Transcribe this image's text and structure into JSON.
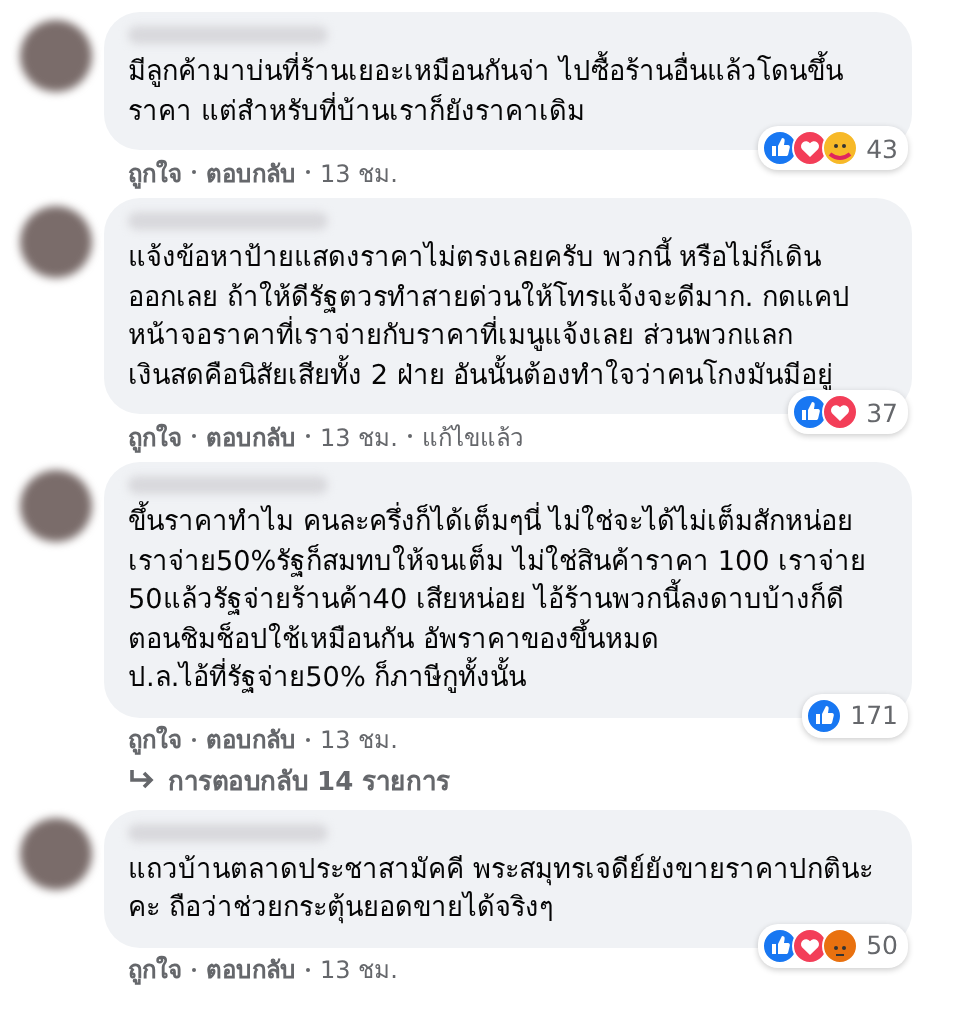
{
  "comments": [
    {
      "text": "มีลูกค้ามาบ่นที่ร้านเยอะเหมือนกันจ่า ไปซื้อร้านอื่นแล้วโดนขึ้น\nราคา แต่สำหรับที่บ้านเราก็ยังราคาเดิม",
      "reactions": [
        {
          "kind": "like"
        },
        {
          "kind": "love"
        },
        {
          "kind": "care"
        }
      ],
      "count": "43",
      "actions": [
        "ถูกใจ",
        "ตอบกลับ"
      ],
      "time": "13 ชม."
    },
    {
      "text": "แจ้งข้อหาป้ายแสดงราคาไม่ตรงเลยครับ พวกนี้ หรือไม่ก็เดิน\nออกเลย ถ้าให้ดีรัฐตวรทำสายด่วนให้โทรแจ้งจะดีมาก. กดแคป\nหน้าจอราคาที่เราจ่ายกับราคาที่เมนูแจ้งเลย ส่วนพวกแลก\nเงินสดคือนิสัยเสียทั้ง 2 ฝ่าย อันนั้นต้องทำใจว่าคนโกงมันมีอยู่",
      "reactions": [
        {
          "kind": "like"
        },
        {
          "kind": "love"
        }
      ],
      "count": "37",
      "actions": [
        "ถูกใจ",
        "ตอบกลับ"
      ],
      "time": "13 ชม.",
      "edited": "แก้ไขแล้ว"
    },
    {
      "text": "ขึ้นราคาทำไม คนละครึ่งก็ได้เต็มๆนี่ ไม่ใช่จะได้ไม่เต็มสักหน่อย\nเราจ่าย50%รัฐก็สมทบให้จนเต็ม ไม่ใช่สินค้าราคา 100 เราจ่าย\n50แล้วรัฐจ่ายร้านค้า40 เสียหน่อย ไอ้ร้านพวกนี้ลงดาบบ้างก็ดี\nตอนชิมช็อปใช้เหมือนกัน อัพราคาของขึ้นหมด\nป.ล.ไอ้ที่รัฐจ่าย50% ก็ภาษีกูทั้งนั้น",
      "reactions": [
        {
          "kind": "like"
        }
      ],
      "count": "171",
      "actions": [
        "ถูกใจ",
        "ตอบกลับ"
      ],
      "time": "13 ชม.",
      "replies": "การตอบกลับ 14 รายการ"
    },
    {
      "text": "แถวบ้านตลาดประชาสามัคคี พระสมุทรเจดีย์ยังขายราคาปกตินะ\nคะ ถือว่าช่วยกระตุ้นยอดขายได้จริงๆ",
      "reactions": [
        {
          "kind": "like"
        },
        {
          "kind": "love"
        },
        {
          "kind": "angry"
        }
      ],
      "count": "50",
      "actions": [
        "ถูกใจ",
        "ตอบกลับ"
      ],
      "time": "13 ชม."
    }
  ]
}
